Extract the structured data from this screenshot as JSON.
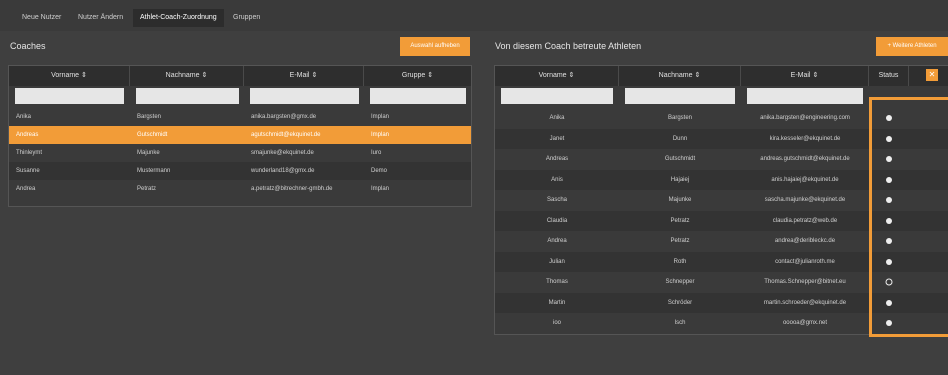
{
  "tabs": [
    {
      "label": "Neue Nutzer",
      "active": false
    },
    {
      "label": "Nutzer Ändern",
      "active": false
    },
    {
      "label": "Athlet-Coach-Zuordnung",
      "active": true
    },
    {
      "label": "Gruppen",
      "active": false
    }
  ],
  "coaches": {
    "title": "Coaches",
    "action_label": "Auswahl aufheben",
    "headers": [
      "Vorname",
      "Nachname",
      "E-Mail",
      "Gruppe"
    ],
    "sort_icon": "⇕",
    "rows": [
      {
        "vorname": "Anika",
        "nachname": "Bargsten",
        "email": "anika.bargsten@gmx.de",
        "gruppe": "Implan",
        "selected": false
      },
      {
        "vorname": "Andreas",
        "nachname": "Gutschmidt",
        "email": "agutschmidt@ekquinet.de",
        "gruppe": "Implan",
        "selected": true
      },
      {
        "vorname": "Thinleymt",
        "nachname": "Majunke",
        "email": "smajunke@ekquinet.de",
        "gruppe": "Iuro",
        "selected": false
      },
      {
        "vorname": "Susanne",
        "nachname": "Mustermann",
        "email": "wunderland18@gmx.de",
        "gruppe": "Demo",
        "selected": false
      },
      {
        "vorname": "Andrea",
        "nachname": "Petratz",
        "email": "a.petratz@bitrechner-gmbh.de",
        "gruppe": "Implan",
        "selected": false
      }
    ]
  },
  "athletes": {
    "title": "Von diesem Coach betreute Athleten",
    "action_label": "+ Weitere Athleten",
    "headers": [
      "Vorname",
      "Nachname",
      "E-Mail",
      "Status"
    ],
    "sort_icon": "⇕",
    "close_label": "✕",
    "rows": [
      {
        "vorname": "Anika",
        "nachname": "Bargsten",
        "email": "anika.bargsten@engineering.com",
        "status": "filled"
      },
      {
        "vorname": "Janet",
        "nachname": "Dunn",
        "email": "kira.kesseler@ekquinet.de",
        "status": "filled"
      },
      {
        "vorname": "Andreas",
        "nachname": "Gutschmidt",
        "email": "andreas.gutschmidt@ekquinet.de",
        "status": "filled"
      },
      {
        "vorname": "Anis",
        "nachname": "Hajaiej",
        "email": "anis.hajaiej@ekquinet.de",
        "status": "filled"
      },
      {
        "vorname": "Sascha",
        "nachname": "Majunke",
        "email": "sascha.majunke@ekquinet.de",
        "status": "filled"
      },
      {
        "vorname": "Claudia",
        "nachname": "Petratz",
        "email": "claudia.petratz@web.de",
        "status": "filled"
      },
      {
        "vorname": "Andrea",
        "nachname": "Petratz",
        "email": "andrea@deribleckc.de",
        "status": "filled"
      },
      {
        "vorname": "Julian",
        "nachname": "Roth",
        "email": "contact@julianroth.me",
        "status": "filled"
      },
      {
        "vorname": "Thomas",
        "nachname": "Schnepper",
        "email": "Thomas.Schnepper@bitnet.eu",
        "status": "empty"
      },
      {
        "vorname": "Martin",
        "nachname": "Schröder",
        "email": "martin.schroeder@ekquinet.de",
        "status": "filled"
      },
      {
        "vorname": "ioo",
        "nachname": "Isch",
        "email": "ooooa@gmx.net",
        "status": "filled"
      }
    ]
  },
  "colors": {
    "accent": "#f29c38",
    "selected_row": "#f29c38"
  }
}
